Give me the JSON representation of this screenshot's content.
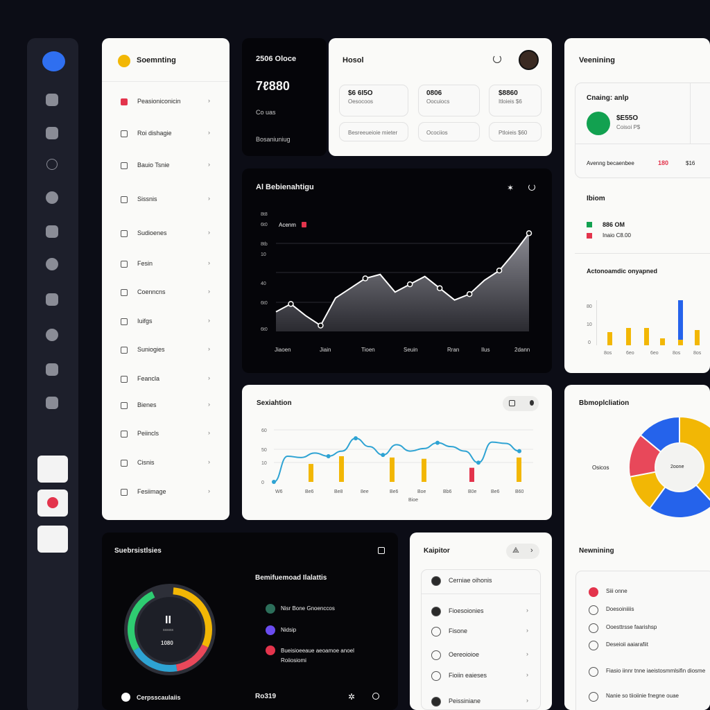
{
  "menu": {
    "title": "Soemnting",
    "items": [
      {
        "label": "Peasioniconicin",
        "icon": "flag-icon"
      },
      {
        "label": "Roi dishagie",
        "icon": "leaf-icon"
      },
      {
        "label": "Bauio Tsnie",
        "icon": "document-icon"
      },
      {
        "label": "Sissnis",
        "icon": "list-icon"
      },
      {
        "label": "Sudioenes",
        "icon": "cog-icon"
      },
      {
        "label": "Fesin",
        "icon": "image-icon"
      },
      {
        "label": "Coenncns",
        "icon": "clock-icon"
      },
      {
        "label": "Iuifgs",
        "icon": "card-icon"
      },
      {
        "label": "Suniogies",
        "icon": "folder-icon"
      },
      {
        "label": "Feancla",
        "icon": "box-icon"
      },
      {
        "label": "Bienes",
        "icon": "tag-icon"
      },
      {
        "label": "Peiincls",
        "icon": "file-icon"
      },
      {
        "label": "Cisnis",
        "icon": "tablet-icon"
      },
      {
        "label": "Fesiimage",
        "icon": "grid-icon"
      }
    ]
  },
  "stat_card": {
    "title": "2506 Oloce",
    "value": "7ℓ880",
    "sub": "Co uas",
    "footer": "Bosaniuniug"
  },
  "header_card": {
    "title": "Hosol",
    "metrics": [
      {
        "value": "$6 6I5O",
        "label": "Oesocoos",
        "footer": "Besreeueioie mieter"
      },
      {
        "value": "0806",
        "label": "Oocuiocs",
        "footer": "Ocociios"
      },
      {
        "value": "$8860",
        "label": "Itloieis $6",
        "footer": "Ptloieis $60"
      }
    ]
  },
  "right_top": {
    "title": "Veenining",
    "sub_title": "Cnaing: anlp",
    "value": "$E55O",
    "sub_value": "Coisoi P$",
    "row_label": "Avenng becaenbee",
    "row_val_red": "180",
    "row_val": "$16",
    "section2_title": "Ibiom",
    "line1": "886 OM",
    "line2": "Inaio C8.00",
    "bars_title": "Actonoamdic onyapned",
    "y_ticks": [
      "80",
      "10",
      "0"
    ],
    "x_ticks": [
      "8os",
      "6eo",
      "6eo",
      "8os",
      "8os",
      "6eo"
    ]
  },
  "chart_data": [
    {
      "type": "area",
      "title": "Al Bebienahtigu",
      "annotation": "Acenm",
      "x": [
        "Jiaoen",
        "Jiain",
        "Tioen",
        "Seuin",
        "Rran",
        "Ilus",
        "2dann"
      ],
      "y_ticks": [
        "8t8",
        "6t0",
        "8tb",
        "10",
        "40",
        "6t0",
        "6t0"
      ],
      "series": [
        {
          "values": [
            10,
            14,
            8,
            3,
            17,
            22,
            27,
            29,
            20,
            24,
            28,
            22,
            16,
            19,
            26,
            31,
            40,
            50
          ]
        }
      ],
      "ylim": [
        0,
        60
      ]
    },
    {
      "type": "line",
      "title": "Sexiahtion",
      "y_ticks": [
        "60",
        "50",
        "10",
        "0"
      ],
      "x": [
        "W6",
        "Be6",
        "Be8",
        "8ee",
        "Be6",
        "Boe",
        "Bb6",
        "B0e",
        "Be6",
        "B60"
      ],
      "x_label": "Bioe",
      "series": [
        {
          "values": [
            0,
            40,
            38,
            45,
            40,
            48,
            68,
            55,
            42,
            58,
            48,
            52,
            61,
            55,
            48,
            30,
            62,
            60,
            48
          ]
        }
      ],
      "bars": [
        28,
        40,
        38,
        36,
        22,
        38
      ],
      "bar_colors": [
        "#f2b705",
        "#f2b705",
        "#f2b705",
        "#f2b705",
        "#e3344c",
        "#f2b705"
      ],
      "ylim": [
        0,
        80
      ]
    },
    {
      "type": "pie",
      "title": "Bbmoplcliation",
      "legend_label": "Osicos",
      "center_label": "2oone",
      "segments": [
        {
          "color": "#f2b705",
          "value": 38
        },
        {
          "color": "#2563eb",
          "value": 22
        },
        {
          "color": "#f2b705",
          "value": 12
        },
        {
          "color": "#e8485a",
          "value": 14
        },
        {
          "color": "#2563eb",
          "value": 14
        }
      ]
    }
  ],
  "subscriptions": {
    "title": "Suebrsistlsies",
    "gauge_big": "II",
    "gauge_small": "ssssss",
    "gauge_value": "1080",
    "footer_left": "Cerpsscaulaiis",
    "right_title": "Bemifuemoad Ilalattis",
    "items": [
      "Nisr Bone Gnoenccos",
      "Nidsip",
      "Bueisioeeaue aeoamoe anoel"
    ],
    "item3_sub": "Roiiosiomi",
    "footer_value": "Ro319"
  },
  "kalipitor": {
    "title": "Kaipitor",
    "items": [
      "Cerniae oihonis",
      "Fioesoionies",
      "Fisone",
      "Oereoioioe",
      "Fioiin eaieses",
      "Peissiniane"
    ]
  },
  "notifications": {
    "title": "Newnining",
    "items": [
      "Siii onne",
      "Doesoiniiiis",
      "Ooesttrsse faarishsp",
      "Deseioii aaiarafiit",
      "Fiasio iinnr tnne iaeistosmmlsifin diosme",
      "Nanie so tiioiinie fnegne ouae"
    ]
  }
}
